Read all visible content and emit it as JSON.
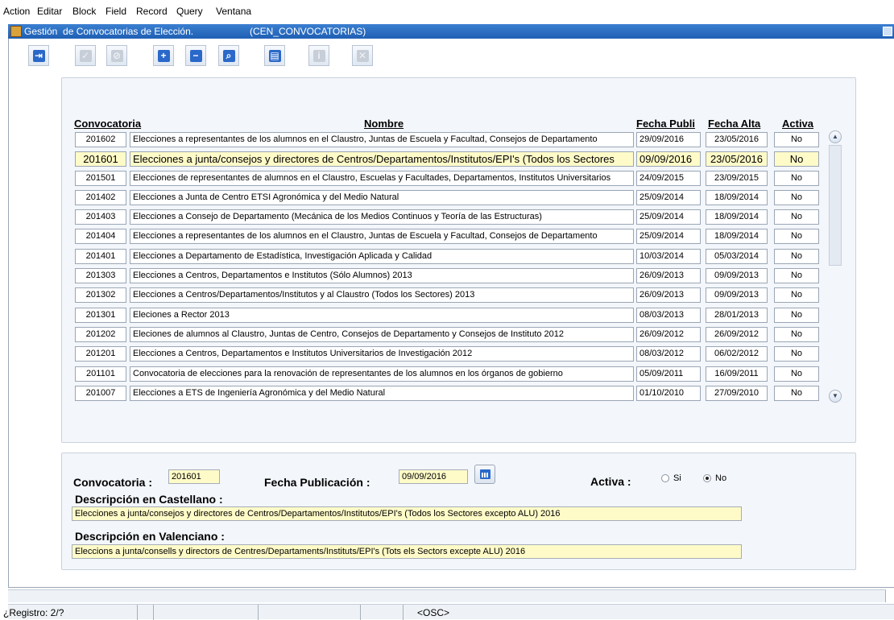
{
  "menu": [
    {
      "label": "Action"
    },
    {
      "label": "Editar"
    },
    {
      "label": "Block"
    },
    {
      "label": "Field"
    },
    {
      "label": "Record"
    },
    {
      "label": "Query"
    },
    {
      "label": "Ventana"
    }
  ],
  "window": {
    "title": "Gestión  de Convocatorias de Elección.",
    "code": "(CEN_CONVOCATORIAS)"
  },
  "toolbar": {
    "buttons": [
      {
        "icon": "exit-icon",
        "enabled": true
      },
      {
        "icon": "check-icon",
        "enabled": false
      },
      {
        "icon": "cancel-icon",
        "enabled": false
      },
      {
        "icon": "plus-icon",
        "enabled": true
      },
      {
        "icon": "minus-icon",
        "enabled": true
      },
      {
        "icon": "search-icon",
        "enabled": true
      },
      {
        "icon": "print-icon",
        "enabled": true
      },
      {
        "icon": "info-icon",
        "enabled": false
      },
      {
        "icon": "clear-icon",
        "enabled": false
      }
    ]
  },
  "list": {
    "headers": {
      "convocatoria": "Convocatoria",
      "nombre": "Nombre",
      "fecha_publi": "Fecha Publi",
      "fecha_alta": "Fecha Alta",
      "activa": "Activa"
    },
    "rows": [
      {
        "conv": "201602",
        "nombre": "Elecciones a representantes de los alumnos en el Claustro, Juntas de Escuela y Facultad, Consejos de Departamento",
        "pub": "29/09/2016",
        "alta": "23/05/2016",
        "activa": "No"
      },
      {
        "conv": "201601",
        "nombre": "Elecciones a junta/consejos y directores de Centros/Departamentos/Institutos/EPI's (Todos los Sectores",
        "pub": "09/09/2016",
        "alta": "23/05/2016",
        "activa": "No"
      },
      {
        "conv": "201501",
        "nombre": "Elecciones de representantes de alumnos en el Claustro, Escuelas y Facultades, Departamentos, Institutos Universitarios",
        "pub": "24/09/2015",
        "alta": "23/09/2015",
        "activa": "No"
      },
      {
        "conv": "201402",
        "nombre": "Elecciones a Junta de Centro ETSI Agronómica y del Medio Natural",
        "pub": "25/09/2014",
        "alta": "18/09/2014",
        "activa": "No"
      },
      {
        "conv": "201403",
        "nombre": "Elecciones a Consejo de Departamento (Mecánica de los Medios Continuos y Teoría de las Estructuras)",
        "pub": "25/09/2014",
        "alta": "18/09/2014",
        "activa": "No"
      },
      {
        "conv": "201404",
        "nombre": "Elecciones a representantes de los alumnos en el Claustro, Juntas de Escuela y Facultad, Consejos de Departamento",
        "pub": "25/09/2014",
        "alta": "18/09/2014",
        "activa": "No"
      },
      {
        "conv": "201401",
        "nombre": "Elecciones a Departamento de Estadística, Investigación Aplicada y Calidad",
        "pub": "10/03/2014",
        "alta": "05/03/2014",
        "activa": "No"
      },
      {
        "conv": "201303",
        "nombre": "Elecciones a Centros, Departamentos e Institutos (Sólo Alumnos) 2013",
        "pub": "26/09/2013",
        "alta": "09/09/2013",
        "activa": "No"
      },
      {
        "conv": "201302",
        "nombre": "Elecciones a Centros/Departamentos/Institutos y al Claustro (Todos los Sectores) 2013",
        "pub": "26/09/2013",
        "alta": "09/09/2013",
        "activa": "No"
      },
      {
        "conv": "201301",
        "nombre": "Eleciones a Rector 2013",
        "pub": "08/03/2013",
        "alta": "28/01/2013",
        "activa": "No"
      },
      {
        "conv": "201202",
        "nombre": "Eleciones de alumnos al Claustro, Juntas de Centro, Consejos de Departamento y Consejos de Instituto 2012",
        "pub": "26/09/2012",
        "alta": "26/09/2012",
        "activa": "No"
      },
      {
        "conv": "201201",
        "nombre": "Elecciones a Centros, Departamentos e Institutos Universitarios de Investigación 2012",
        "pub": "08/03/2012",
        "alta": "06/02/2012",
        "activa": "No"
      },
      {
        "conv": "201101",
        "nombre": "Convocatoria de elecciones para la renovación de representantes de los alumnos en los órganos de gobierno",
        "pub": "05/09/2011",
        "alta": "16/09/2011",
        "activa": "No"
      },
      {
        "conv": "201007",
        "nombre": "Elecciones a ETS de Ingeniería Agronómica y del Medio Natural",
        "pub": "01/10/2010",
        "alta": "27/09/2010",
        "activa": "No"
      }
    ]
  },
  "detail": {
    "convocatoria_label": "Convocatoria :",
    "convocatoria_value": "201601",
    "fecha_label": "Fecha Publicación :",
    "fecha_value": "09/09/2016",
    "activa_label": "Activa :",
    "activa_si": "Si",
    "activa_no": "No",
    "activa_selected": "No",
    "desc_cast_label": "Descripción  en Castellano :",
    "desc_cast_value": "Elecciones a junta/consejos y directores de Centros/Departamentos/Institutos/EPI's (Todos los Sectores excepto ALU) 2016",
    "desc_val_label": "Descripción  en  Valenciano :",
    "desc_val_value": "Eleccions a junta/consells y directors de Centres/Departaments/Instituts/EPI's (Tots els Sectors excepte ALU) 2016"
  },
  "status": {
    "registro": "¿Registro: 2/?",
    "mode": "<OSC>"
  }
}
